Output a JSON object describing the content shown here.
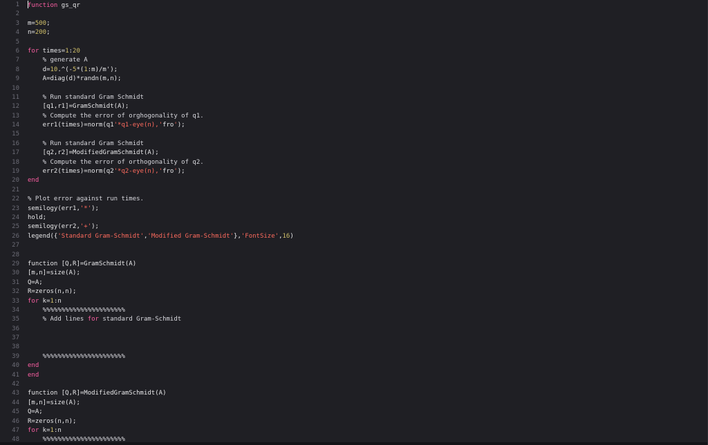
{
  "editor": {
    "colors": {
      "background": "#1f1f24",
      "keyword": "#fc5fa3",
      "number": "#d0bf69",
      "string": "#fc6a5d",
      "plain": "#e6e6e8",
      "line_number": "#6b6b75"
    },
    "lines": [
      {
        "n": "1",
        "tokens": [
          {
            "t": "kw",
            "v": "function"
          },
          {
            "t": "plain",
            "v": " gs_qr"
          }
        ]
      },
      {
        "n": "2",
        "tokens": []
      },
      {
        "n": "3",
        "tokens": [
          {
            "t": "plain",
            "v": "m="
          },
          {
            "t": "num",
            "v": "500"
          },
          {
            "t": "plain",
            "v": ";"
          }
        ]
      },
      {
        "n": "4",
        "tokens": [
          {
            "t": "plain",
            "v": "n="
          },
          {
            "t": "num",
            "v": "200"
          },
          {
            "t": "plain",
            "v": ";"
          }
        ]
      },
      {
        "n": "5",
        "tokens": []
      },
      {
        "n": "6",
        "tokens": [
          {
            "t": "kw",
            "v": "for"
          },
          {
            "t": "plain",
            "v": " times="
          },
          {
            "t": "num",
            "v": "1"
          },
          {
            "t": "plain",
            "v": ":"
          },
          {
            "t": "num",
            "v": "20"
          }
        ]
      },
      {
        "n": "7",
        "tokens": [
          {
            "t": "comment",
            "v": "    % generate A"
          }
        ]
      },
      {
        "n": "8",
        "tokens": [
          {
            "t": "plain",
            "v": "    d="
          },
          {
            "t": "num",
            "v": "10"
          },
          {
            "t": "plain",
            "v": ".^(-"
          },
          {
            "t": "num",
            "v": "5"
          },
          {
            "t": "plain",
            "v": "*("
          },
          {
            "t": "num",
            "v": "1"
          },
          {
            "t": "plain",
            "v": ":m)/m'"
          },
          {
            "t": "plain",
            "v": ");"
          }
        ]
      },
      {
        "n": "9",
        "tokens": [
          {
            "t": "plain",
            "v": "    A=diag(d)*randn(m,n);"
          }
        ]
      },
      {
        "n": "10",
        "tokens": []
      },
      {
        "n": "11",
        "tokens": [
          {
            "t": "comment",
            "v": "    % Run standard Gram Schmidt"
          }
        ]
      },
      {
        "n": "12",
        "tokens": [
          {
            "t": "plain",
            "v": "    [q1,r1]=GramSchmidt(A);"
          }
        ]
      },
      {
        "n": "13",
        "tokens": [
          {
            "t": "comment",
            "v": "    % Compute the error of orghogonality of q1."
          }
        ]
      },
      {
        "n": "14",
        "tokens": [
          {
            "t": "plain",
            "v": "    err1(times)=norm(q1"
          },
          {
            "t": "str",
            "v": "'*q1-eye(n),'"
          },
          {
            "t": "plain",
            "v": "fro"
          },
          {
            "t": "str",
            "v": "'"
          },
          {
            "t": "plain",
            "v": ");"
          }
        ]
      },
      {
        "n": "15",
        "tokens": []
      },
      {
        "n": "16",
        "tokens": [
          {
            "t": "comment",
            "v": "    % Run standard Gram Schmidt"
          }
        ]
      },
      {
        "n": "17",
        "tokens": [
          {
            "t": "plain",
            "v": "    [q2,r2]=ModifiedGramSchmidt(A);"
          }
        ]
      },
      {
        "n": "18",
        "tokens": [
          {
            "t": "comment",
            "v": "    % Compute the error of orthogonality of q2."
          }
        ]
      },
      {
        "n": "19",
        "tokens": [
          {
            "t": "plain",
            "v": "    err2(times)=norm(q2"
          },
          {
            "t": "str",
            "v": "'*q2-eye(n),'"
          },
          {
            "t": "plain",
            "v": "fro"
          },
          {
            "t": "str",
            "v": "'"
          },
          {
            "t": "plain",
            "v": ");"
          }
        ]
      },
      {
        "n": "20",
        "tokens": [
          {
            "t": "kw",
            "v": "end"
          }
        ]
      },
      {
        "n": "21",
        "tokens": []
      },
      {
        "n": "22",
        "tokens": [
          {
            "t": "comment",
            "v": "% Plot error against run times."
          }
        ]
      },
      {
        "n": "23",
        "tokens": [
          {
            "t": "plain",
            "v": "semilogy(err1,"
          },
          {
            "t": "str",
            "v": "'*'"
          },
          {
            "t": "plain",
            "v": ");"
          }
        ]
      },
      {
        "n": "24",
        "tokens": [
          {
            "t": "plain",
            "v": "hold;"
          }
        ]
      },
      {
        "n": "25",
        "tokens": [
          {
            "t": "plain",
            "v": "semilogy(err2,"
          },
          {
            "t": "str",
            "v": "'+'"
          },
          {
            "t": "plain",
            "v": ");"
          }
        ]
      },
      {
        "n": "26",
        "tokens": [
          {
            "t": "plain",
            "v": "legend({"
          },
          {
            "t": "str",
            "v": "'Standard Gram-Schmidt'"
          },
          {
            "t": "plain",
            "v": ","
          },
          {
            "t": "str",
            "v": "'Modified Gram-Schmidt'"
          },
          {
            "t": "plain",
            "v": "},"
          },
          {
            "t": "str",
            "v": "'FontSize'"
          },
          {
            "t": "plain",
            "v": ","
          },
          {
            "t": "num",
            "v": "16"
          },
          {
            "t": "plain",
            "v": ")"
          }
        ]
      },
      {
        "n": "27",
        "tokens": []
      },
      {
        "n": "28",
        "tokens": []
      },
      {
        "n": "29",
        "tokens": [
          {
            "t": "plain",
            "v": "function [Q,R]=GramSchmidt(A)"
          }
        ]
      },
      {
        "n": "30",
        "tokens": [
          {
            "t": "plain",
            "v": "[m,n]=size(A);"
          }
        ]
      },
      {
        "n": "31",
        "tokens": [
          {
            "t": "plain",
            "v": "Q=A;"
          }
        ]
      },
      {
        "n": "32",
        "tokens": [
          {
            "t": "plain",
            "v": "R=zeros(n,n);"
          }
        ]
      },
      {
        "n": "33",
        "tokens": [
          {
            "t": "kw",
            "v": "for"
          },
          {
            "t": "plain",
            "v": " k="
          },
          {
            "t": "num",
            "v": "1"
          },
          {
            "t": "plain",
            "v": ":n"
          }
        ]
      },
      {
        "n": "34",
        "tokens": [
          {
            "t": "comment",
            "v": "    %%%%%%%%%%%%%%%%%%%%%%"
          }
        ]
      },
      {
        "n": "35",
        "tokens": [
          {
            "t": "comment",
            "v": "    % Add lines "
          },
          {
            "t": "kw",
            "v": "for"
          },
          {
            "t": "comment",
            "v": " standard Gram-Schmidt"
          }
        ]
      },
      {
        "n": "36",
        "tokens": []
      },
      {
        "n": "37",
        "tokens": []
      },
      {
        "n": "38",
        "tokens": []
      },
      {
        "n": "39",
        "tokens": [
          {
            "t": "comment",
            "v": "    %%%%%%%%%%%%%%%%%%%%%%"
          }
        ]
      },
      {
        "n": "40",
        "tokens": [
          {
            "t": "kw",
            "v": "end"
          }
        ]
      },
      {
        "n": "41",
        "tokens": [
          {
            "t": "kw",
            "v": "end"
          }
        ]
      },
      {
        "n": "42",
        "tokens": []
      },
      {
        "n": "43",
        "tokens": [
          {
            "t": "plain",
            "v": "function [Q,R]=ModifiedGramSchmidt(A)"
          }
        ]
      },
      {
        "n": "44",
        "tokens": [
          {
            "t": "plain",
            "v": "[m,n]=size(A);"
          }
        ]
      },
      {
        "n": "45",
        "tokens": [
          {
            "t": "plain",
            "v": "Q=A;"
          }
        ]
      },
      {
        "n": "46",
        "tokens": [
          {
            "t": "plain",
            "v": "R=zeros(n,n);"
          }
        ]
      },
      {
        "n": "47",
        "tokens": [
          {
            "t": "kw",
            "v": "for"
          },
          {
            "t": "plain",
            "v": " k="
          },
          {
            "t": "num",
            "v": "1"
          },
          {
            "t": "plain",
            "v": ":n"
          }
        ]
      },
      {
        "n": "48",
        "tokens": [
          {
            "t": "comment",
            "v": "    %%%%%%%%%%%%%%%%%%%%%%"
          }
        ]
      }
    ]
  }
}
